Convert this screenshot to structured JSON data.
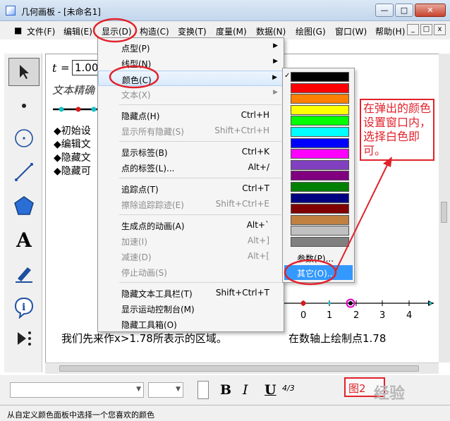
{
  "window": {
    "title": "几何画板 - [未命名1]",
    "controls": [
      "—",
      "□",
      "✕"
    ],
    "mdi_controls": [
      "_",
      "□",
      "x"
    ]
  },
  "menubar": {
    "items": [
      {
        "label": "文件(F)"
      },
      {
        "label": "编辑(E)"
      },
      {
        "label": "显示(D)"
      },
      {
        "label": "构造(C)"
      },
      {
        "label": "变换(T)"
      },
      {
        "label": "度量(M)"
      },
      {
        "label": "数据(N)"
      },
      {
        "label": "绘图(G)"
      },
      {
        "label": "窗口(W)"
      },
      {
        "label": "帮助(H)"
      }
    ]
  },
  "toolbar": {
    "tools": [
      "arrow-select-tool",
      "point-tool",
      "compass-tool",
      "straightedge-tool",
      "polygon-tool",
      "text-tool",
      "marker-tool",
      "information-tool",
      "custom-tool"
    ],
    "text_tool_glyph": "A"
  },
  "canvas": {
    "param_name": "t",
    "param_eq": "=",
    "param_value": "1.00",
    "text_line": "文本精确",
    "bullets": [
      "◆初始设",
      "◆编辑文",
      "◆隐藏文",
      "◆隐藏可"
    ],
    "axis_ticks": [
      "0",
      "1",
      "2",
      "3",
      "4"
    ],
    "caption_left": "我们先来作x>1.78所表示的区域。",
    "caption_right": "在数轴上绘制点1.78"
  },
  "display_menu": {
    "items": [
      {
        "label": "点型(P)",
        "shortcut": "",
        "submenu": true,
        "enabled": true
      },
      {
        "label": "线型(N)",
        "shortcut": "",
        "submenu": true,
        "enabled": true
      },
      {
        "label": "颜色(C)",
        "shortcut": "",
        "submenu": true,
        "enabled": true,
        "highlighted": true
      },
      {
        "label": "文本(X)",
        "shortcut": "",
        "submenu": true,
        "enabled": false
      },
      {
        "label": "隐藏点(H)",
        "shortcut": "Ctrl+H",
        "enabled": true
      },
      {
        "label": "显示所有隐藏(S)",
        "shortcut": "Shift+Ctrl+H",
        "enabled": false
      },
      {
        "label": "显示标签(B)",
        "shortcut": "Ctrl+K",
        "enabled": true
      },
      {
        "label": "点的标签(L)...",
        "shortcut": "Alt+/",
        "enabled": true
      },
      {
        "label": "追踪点(T)",
        "shortcut": "Ctrl+T",
        "enabled": true
      },
      {
        "label": "擦除追踪踪迹(E)",
        "shortcut": "Shift+Ctrl+E",
        "enabled": false
      },
      {
        "label": "生成点的动画(A)",
        "shortcut": "Alt+`",
        "enabled": true
      },
      {
        "label": "加速(I)",
        "shortcut": "Alt+]",
        "enabled": false
      },
      {
        "label": "减速(D)",
        "shortcut": "Alt+[",
        "enabled": false
      },
      {
        "label": "停止动画(S)",
        "shortcut": "",
        "enabled": false
      },
      {
        "label": "隐藏文本工具栏(T)",
        "shortcut": "Shift+Ctrl+T",
        "enabled": true
      },
      {
        "label": "显示运动控制台(M)",
        "shortcut": "",
        "enabled": true
      },
      {
        "label": "隐藏工具箱(O)",
        "shortcut": "",
        "enabled": true
      }
    ]
  },
  "color_palette": {
    "swatches": [
      "#000000",
      "#ff0000",
      "#ff8000",
      "#ffff00",
      "#00ff00",
      "#00ffff",
      "#0000ff",
      "#ff00ff",
      "#8040c0",
      "#800080",
      "#008000",
      "#000080",
      "#800000",
      "#c08040",
      "#c0c0c0",
      "#808080"
    ],
    "items": [
      {
        "label": "参数(P)..."
      },
      {
        "label": "其它(O)...",
        "selected": true
      }
    ]
  },
  "annotation": {
    "callout_text": "在弹出的颜色设置窗口内，选择白色即可。",
    "figure_label": "图2",
    "watermark": "经验"
  },
  "format_bar": {
    "bold": "B",
    "italic": "I",
    "underline": "U",
    "fraction_icon": "4/3"
  },
  "status": {
    "text": "从自定义颜色面板中选择一个您喜欢的颜色"
  },
  "colors": {
    "accent_red": "#e1222b",
    "selection_blue": "#3399ff"
  }
}
